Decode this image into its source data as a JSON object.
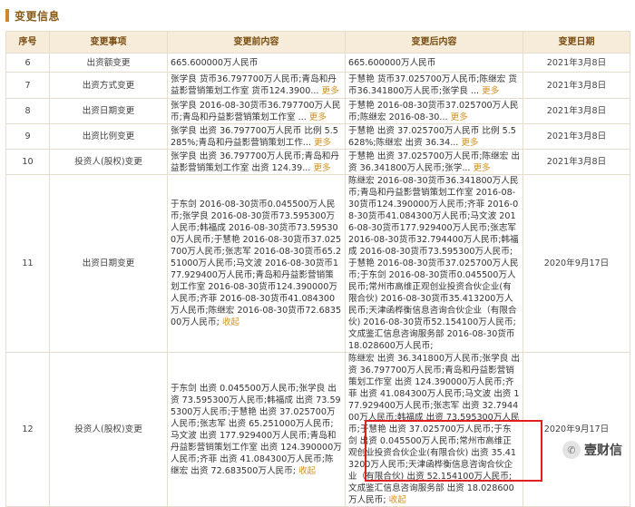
{
  "section": {
    "title": "变更信息"
  },
  "table": {
    "headers": [
      "序号",
      "变更事项",
      "变更前内容",
      "变更后内容",
      "变更日期"
    ],
    "rows": [
      {
        "num": "6",
        "item": "出资额变更",
        "before": "665.600000万人民币",
        "before_more": "",
        "after": "665.600000万人民币",
        "after_more": "",
        "date": "2021年3月8日"
      },
      {
        "num": "7",
        "item": "出资方式变更",
        "before": "张学良 货币36.797700万人民币;青岛和丹益影营销策划工作室 货币124.3900...",
        "before_more": "更多",
        "after": "于慧艳 货币37.025700万人民币;陈继宏 货币36.341800万人民币;张学良 ...",
        "after_more": "更多",
        "date": "2021年3月8日"
      },
      {
        "num": "8",
        "item": "出资日期变更",
        "before": "张学良 2016-08-30货币36.797700万人民币;青岛和丹益影营销策划工作室 ...",
        "before_more": "更多",
        "after": "于慧艳 2016-08-30货币37.025700万人民币;陈继宏 2016-08-30...",
        "after_more": "更多",
        "date": "2021年3月8日"
      },
      {
        "num": "9",
        "item": "出资比例变更",
        "before": "张学良 出资 36.797700万人民币 比例 5.5285%;青岛和丹益影营销策划工作...",
        "before_more": "更多",
        "after": "于慧艳 出资 37.025700万人民币 比例 5.5628%;陈继宏 出资 36.34...",
        "after_more": "更多",
        "date": "2021年3月8日"
      },
      {
        "num": "10",
        "item": "投资人(股权)变更",
        "before": "张学良 出资 36.797700万人民币;青岛和丹益影营销策划工作室 出资 124.39...",
        "before_more": "更多",
        "after": "于慧艳 出资 37.025700万人民币;陈继宏 出资 36.341800万人民币;张学...",
        "after_more": "更多",
        "date": "2021年3月8日"
      },
      {
        "num": "11",
        "item": "出资日期变更",
        "before": "于东剑 2016-08-30货币0.045500万人民币;张学良 2016-08-30货币73.595300万人民币;韩福成 2016-08-30货币73.595300万人民币;于慧艳 2016-08-30货币37.025700万人民币;张志军 2016-08-30货币65.251000万人民币;马文波 2016-08-30货币177.929400万人民币;青岛和丹益影营销策划工作室 2016-08-30货币124.390000万人民币;齐菲 2016-08-30货币41.084300万人民币;陈继宏 2016-08-30货币72.683500万人民币;",
        "before_more": "收起",
        "after": "陈继宏 2016-08-30货币36.341800万人民币;青岛和丹益影营销策划工作室 2016-08-30货币124.390000万人民币;齐菲 2016-08-30货币41.084300万人民币;马文波 2016-08-30货币177.929400万人民币;张志军 2016-08-30货币32.794400万人民币;韩福成 2016-08-30货币73.595300万人民币;于慧艳 2016-08-30货币37.025700万人民币;于东剑 2016-08-30货币0.045500万人民币;常州市高维正观创业投资合伙企业(有限合伙) 2016-08-30货币35.413200万人民币;天津函桦衡信息咨询合伙企业（有限合伙) 2016-08-30货币52.154100万人民币;文成鉴汇信息咨询服务部 2016-08-30货币18.028600万人民币;",
        "after_more": "",
        "date": "2020年9月17日"
      },
      {
        "num": "12",
        "item": "投资人(股权)变更",
        "before": "于东剑 出资 0.045500万人民币;张学良 出资 73.595300万人民币;韩福成 出资 73.595300万人民币;于慧艳 出资 37.025700万人民币;张志军 出资 65.251000万人民币;马文波 出资 177.929400万人民币;青岛和丹益影营销策划工作室 出资 124.390000万人民币;齐菲 出资 41.084300万人民币;陈继宏 出资 72.683500万人民币;",
        "before_more": "收起",
        "after": "陈继宏 出资 36.341800万人民币;张学良 出资 36.797700万人民币;青岛和丹益影营销策划工作室 出资 124.390000万人民币;齐菲 出资 41.084300万人民币;马文波 出资 177.929400万人民币;张志军 出资 32.794400万人民币;韩福成 出资 73.595300万人民币;于慧艳 出资 37.025700万人民币;于东剑 出资 0.045500万人民币;常州市高维正观创业投资合伙企业(有限合伙) 出资 35.413200万人民币;天津函桦衡信息咨询合伙企业（有限合伙) 出资 52.154100万人民币;文成鉴汇信息咨询服务部 出资 18.028600万人民币;",
        "after_more": "收起",
        "date": "2020年9月17日"
      }
    ]
  },
  "watermark": {
    "text": "壹财信",
    "icon": "wechat-icon"
  },
  "colors": {
    "header_bg": "#f6ecd9",
    "link": "#d49120",
    "highlight": "#e02020",
    "accent": "#c98a2e"
  }
}
